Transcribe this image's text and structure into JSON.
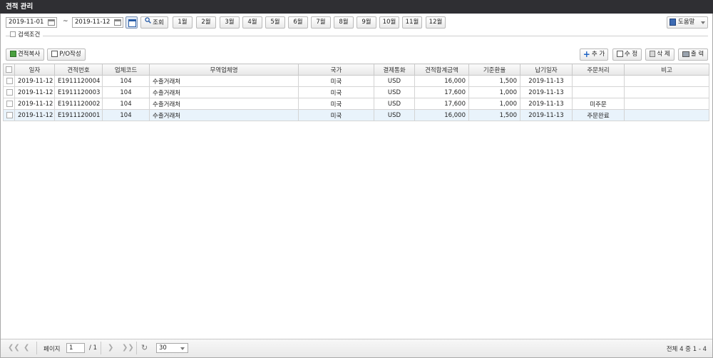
{
  "window": {
    "title": "견적 관리"
  },
  "search": {
    "date_from": "2019-11-01",
    "date_sep": "~",
    "date_to": "2019-11-12",
    "search_label": "조회",
    "months": [
      "1월",
      "2월",
      "3월",
      "4월",
      "5월",
      "6월",
      "7월",
      "8월",
      "9월",
      "10월",
      "11월",
      "12월"
    ],
    "help_label": "도움말",
    "condition_label": "검색조건"
  },
  "toolbar": {
    "copy_label": "견적복사",
    "po_label": "P/O작성",
    "add_label": "추 가",
    "edit_label": "수 정",
    "delete_label": "삭 제",
    "print_label": "출 력"
  },
  "table": {
    "columns": [
      "일자",
      "견적번호",
      "업체코드",
      "무역업체명",
      "국가",
      "결제통화",
      "견적합계금액",
      "기준환율",
      "납기일자",
      "주문처리",
      "비고"
    ],
    "rows": [
      [
        "2019-11-12",
        "E1911120004",
        "104",
        "수출거래처",
        "미국",
        "USD",
        "16,000",
        "1,500",
        "2019-11-13",
        "",
        ""
      ],
      [
        "2019-11-12",
        "E1911120003",
        "104",
        "수출거래처",
        "미국",
        "USD",
        "17,600",
        "1,000",
        "2019-11-13",
        "",
        ""
      ],
      [
        "2019-11-12",
        "E1911120002",
        "104",
        "수출거래처",
        "미국",
        "USD",
        "17,600",
        "1,000",
        "2019-11-13",
        "미주문",
        ""
      ],
      [
        "2019-11-12",
        "E1911120001",
        "104",
        "수출거래처",
        "미국",
        "USD",
        "16,000",
        "1,500",
        "2019-11-13",
        "주문완료",
        ""
      ]
    ]
  },
  "pager": {
    "page_label": "페이지",
    "page_value": "1",
    "page_total": "/ 1",
    "page_size": "30",
    "info": "전체 4 중 1 - 4"
  }
}
